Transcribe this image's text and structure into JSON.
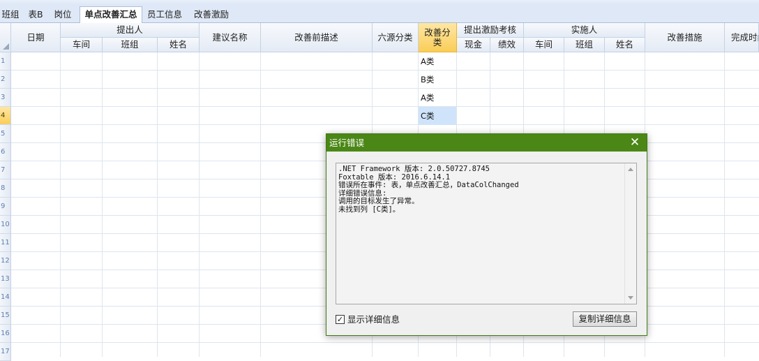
{
  "tabs": [
    {
      "label": "班组",
      "active": false
    },
    {
      "label": "表B",
      "active": false
    },
    {
      "label": "岗位",
      "active": false
    },
    {
      "label": "单点改善汇总",
      "active": true
    },
    {
      "label": "员工信息",
      "active": false
    },
    {
      "label": "改善激励",
      "active": false
    }
  ],
  "grid": {
    "headers": {
      "date": "日期",
      "proposer": "提出人",
      "proposer_workshop": "车间",
      "proposer_team": "班组",
      "proposer_name": "姓名",
      "proposal_name": "建议名称",
      "before_desc": "改善前描述",
      "six_source": "六源分类",
      "improve_class": "改善分类",
      "incentive": "提出激励考核",
      "cash": "现金",
      "performance": "绩效",
      "implementer": "实施人",
      "impl_workshop": "车间",
      "impl_team": "班组",
      "impl_name": "姓名",
      "measures": "改善措施",
      "completion": "完成时间"
    },
    "row_numbers": [
      "1",
      "2",
      "3",
      "4",
      "5",
      "6",
      "7",
      "8",
      "9",
      "10",
      "11",
      "12",
      "13",
      "14",
      "15",
      "16",
      "17"
    ],
    "current_row": 4,
    "improve_class_values": [
      "A类",
      "B类",
      "A类",
      "C类"
    ],
    "selected_value_row": 4
  },
  "dialog": {
    "title": "运行错误",
    "lines": [
      ".NET Framework 版本: 2.0.50727.8745",
      "Foxtable 版本: 2016.6.14.1",
      "错误所在事件: 表，单点改善汇总，DataColChanged",
      "详细错误信息:",
      "调用的目标发生了异常。",
      "未找到列 [C类]。"
    ],
    "show_details_label": "显示详细信息",
    "show_details_checked": true,
    "copy_button_label": "复制详细信息"
  }
}
